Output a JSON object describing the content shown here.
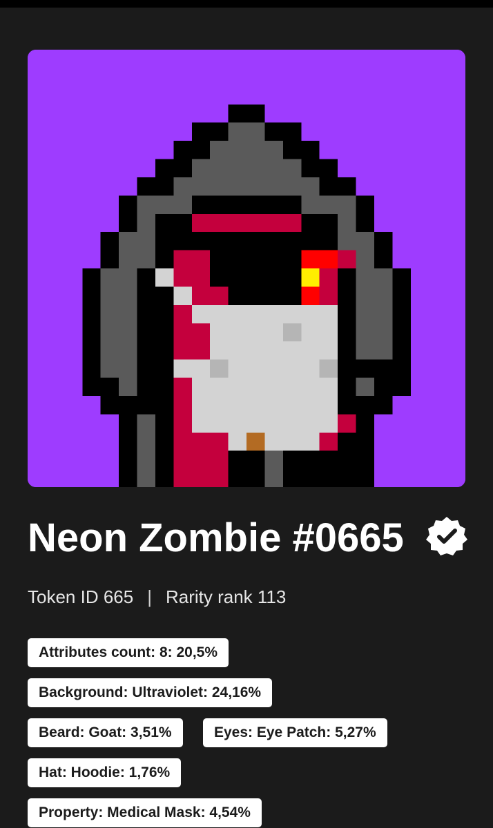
{
  "nft": {
    "title": "Neon Zombie #0665",
    "image_alt": "Neon Zombie #0665 pixel art",
    "verified_icon": "verified-badge-icon",
    "background_color": "#9e3cff",
    "token_id": "Token ID 665",
    "separator": "|",
    "rarity": "Rarity rank 113"
  },
  "attributes": [
    "Attributes count: 8: 20,5%",
    "Background: Ultraviolet: 24,16%",
    "Beard: Goat: 3,51%",
    "Eyes: Eye Patch: 5,27%",
    "Hat: Hoodie: 1,76%",
    "Property: Medical Mask: 4,54%"
  ],
  "colors": {
    "page_bg": "#1b1b1b",
    "hood": "#5a5a5a",
    "skin": "#c4003d",
    "mask": "#d3d3d3",
    "eye_red": "#ff0000",
    "eye_yellow": "#ffee00"
  }
}
